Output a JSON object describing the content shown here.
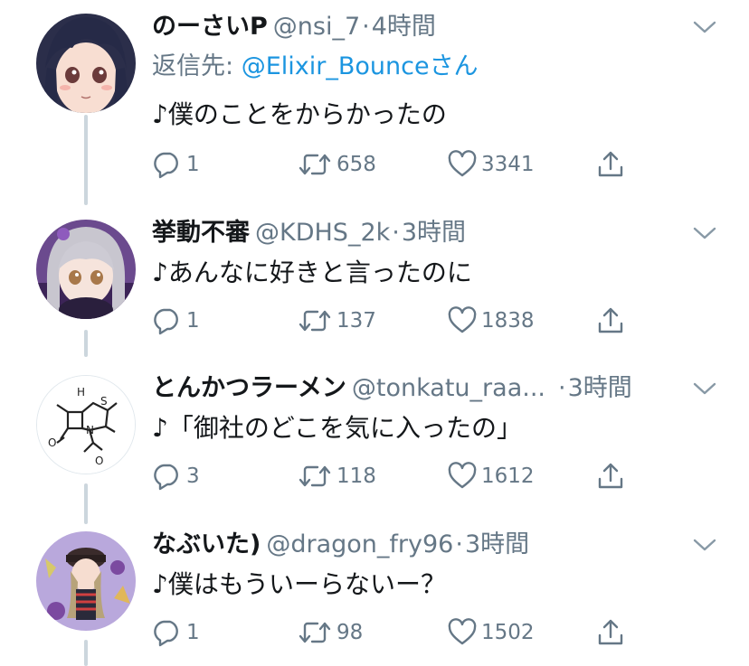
{
  "tweets": [
    {
      "name": "のーさいP",
      "handle": "@nsi_7",
      "separator": "·",
      "time": "4時間",
      "reply_prefix": "返信先: ",
      "reply_user": "@Elixir_Bounce",
      "reply_suffix": "さん",
      "text": "♪僕のことをからかったの",
      "replies": "1",
      "retweets": "658",
      "likes": "3341"
    },
    {
      "name": "挙動不審",
      "handle": "@KDHS_2k",
      "separator": "·",
      "time": "3時間",
      "text": "♪あんなに好きと言ったのに",
      "replies": "1",
      "retweets": "137",
      "likes": "1838"
    },
    {
      "name": "とんかつラーメン",
      "handle": "@tonkatu_raa...",
      "separator": "·",
      "time": "3時間",
      "text": "♪「御社のどこを気に入ったの」",
      "replies": "3",
      "retweets": "118",
      "likes": "1612"
    },
    {
      "name": "なぶいた)",
      "handle": "@dragon_fry96",
      "separator": "·",
      "time": "3時間",
      "text": "♪僕はもういーらないー？",
      "replies": "1",
      "retweets": "98",
      "likes": "1502"
    }
  ],
  "avatar3_labels": {
    "h": "H",
    "s": "S",
    "n": "N",
    "o1": "O",
    "o2": "O"
  },
  "colors": {
    "link": "#1b95e0",
    "secondary_text": "#657786",
    "thread_line": "#ccd6dd"
  }
}
